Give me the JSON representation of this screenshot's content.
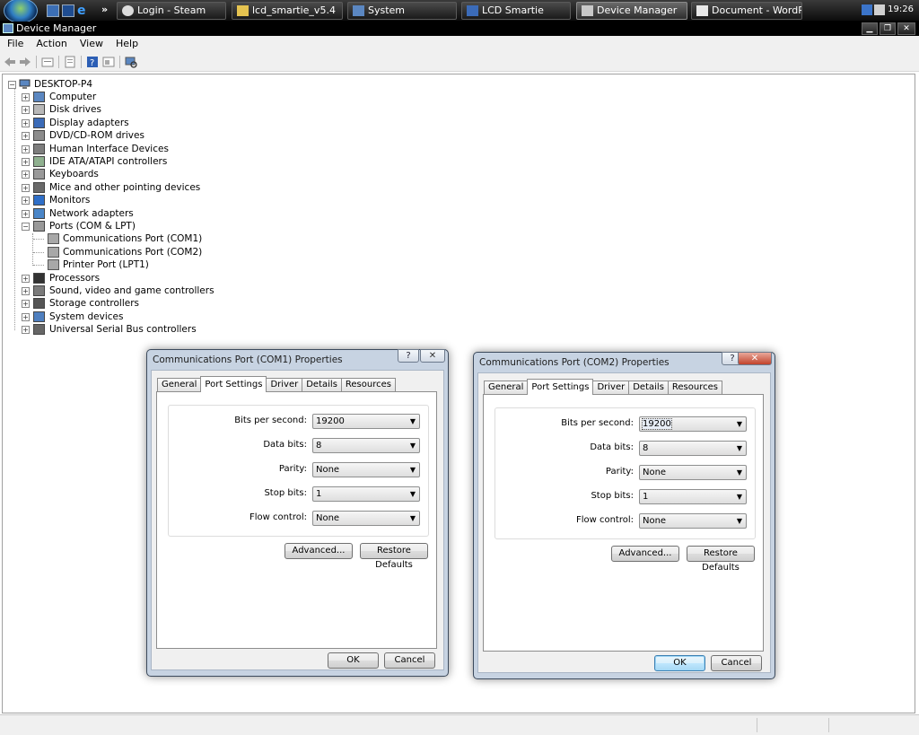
{
  "taskbar": {
    "buttons": [
      {
        "label": "Login - Steam"
      },
      {
        "label": "lcd_smartie_v5.4"
      },
      {
        "label": "System"
      },
      {
        "label": "LCD Smartie"
      },
      {
        "label": "Device Manager",
        "active": true
      },
      {
        "label": "Document - WordPad"
      }
    ],
    "clock": "19:26",
    "more_glyph": "»"
  },
  "window": {
    "title": "Device Manager",
    "controls": {
      "minimize": "▁",
      "restore": "❐",
      "close": "✕"
    }
  },
  "menu": [
    "File",
    "Action",
    "View",
    "Help"
  ],
  "tree": {
    "root": "DESKTOP-P4",
    "items": [
      {
        "label": "Computer",
        "icon": "computer-icon"
      },
      {
        "label": "Disk drives",
        "icon": "disk-drive-icon"
      },
      {
        "label": "Display adapters",
        "icon": "display-adapter-icon"
      },
      {
        "label": "DVD/CD-ROM drives",
        "icon": "dvd-drive-icon"
      },
      {
        "label": "Human Interface Devices",
        "icon": "hid-icon"
      },
      {
        "label": "IDE ATA/ATAPI controllers",
        "icon": "ide-controller-icon"
      },
      {
        "label": "Keyboards",
        "icon": "keyboard-icon"
      },
      {
        "label": "Mice and other pointing devices",
        "icon": "mouse-icon"
      },
      {
        "label": "Monitors",
        "icon": "monitor-icon"
      },
      {
        "label": "Network adapters",
        "icon": "network-adapter-icon"
      },
      {
        "label": "Ports (COM & LPT)",
        "icon": "port-icon",
        "expanded": true,
        "children": [
          "Communications Port (COM1)",
          "Communications Port (COM2)",
          "Printer Port (LPT1)"
        ]
      },
      {
        "label": "Processors",
        "icon": "processor-icon"
      },
      {
        "label": "Sound, video and game controllers",
        "icon": "sound-icon"
      },
      {
        "label": "Storage controllers",
        "icon": "storage-controller-icon"
      },
      {
        "label": "System devices",
        "icon": "system-device-icon"
      },
      {
        "label": "Universal Serial Bus controllers",
        "icon": "usb-icon"
      }
    ]
  },
  "dialog1": {
    "title": "Communications Port (COM1) Properties",
    "tabs": [
      "General",
      "Port Settings",
      "Driver",
      "Details",
      "Resources"
    ],
    "active_tab": "Port Settings",
    "fields": [
      {
        "label": "Bits per second:",
        "value": "19200"
      },
      {
        "label": "Data bits:",
        "value": "8"
      },
      {
        "label": "Parity:",
        "value": "None"
      },
      {
        "label": "Stop bits:",
        "value": "1"
      },
      {
        "label": "Flow control:",
        "value": "None"
      }
    ],
    "advanced": "Advanced...",
    "restore": "Restore Defaults",
    "ok": "OK",
    "cancel": "Cancel",
    "help_glyph": "?",
    "close_glyph": "✕"
  },
  "dialog2": {
    "title": "Communications Port (COM2) Properties",
    "tabs": [
      "General",
      "Port Settings",
      "Driver",
      "Details",
      "Resources"
    ],
    "active_tab": "Port Settings",
    "fields": [
      {
        "label": "Bits per second:",
        "value": "19200"
      },
      {
        "label": "Data bits:",
        "value": "8"
      },
      {
        "label": "Parity:",
        "value": "None"
      },
      {
        "label": "Stop bits:",
        "value": "1"
      },
      {
        "label": "Flow control:",
        "value": "None"
      }
    ],
    "advanced": "Advanced...",
    "restore": "Restore Defaults",
    "ok": "OK",
    "cancel": "Cancel",
    "help_glyph": "?",
    "close_glyph": "✕"
  },
  "colors": {
    "taskbar": "#1a1a1a",
    "dialog_frame": "#c7d3e2",
    "close_button": "#c1422c",
    "default_button": "#3c7fb1"
  }
}
